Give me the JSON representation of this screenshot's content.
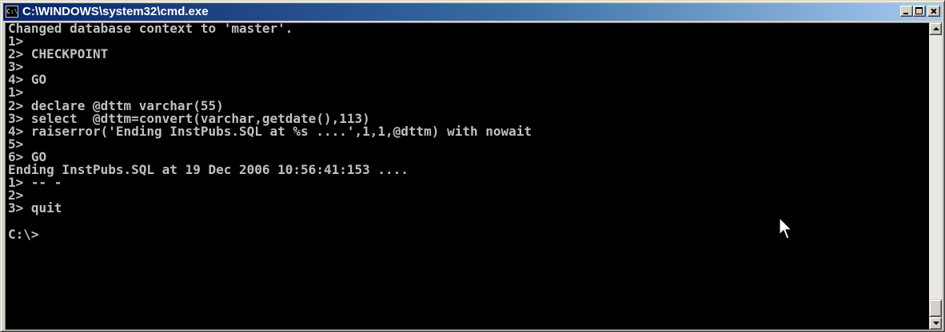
{
  "window": {
    "title": "C:\\WINDOWS\\system32\\cmd.exe",
    "icon_label": "C:\\"
  },
  "console": {
    "lines": [
      "Changed database context to 'master'.",
      "1>",
      "2> CHECKPOINT",
      "3>",
      "4> GO",
      "1>",
      "2> declare @dttm varchar(55)",
      "3> select  @dttm=convert(varchar,getdate(),113)",
      "4> raiserror('Ending InstPubs.SQL at %s ....',1,1,@dttm) with nowait",
      "5>",
      "6> GO",
      "Ending InstPubs.SQL at 19 Dec 2006 10:56:41:153 ....",
      "1> -- -",
      "2>",
      "3> quit",
      "",
      "C:\\>"
    ],
    "text_color": "#c0c0c0",
    "background": "#000000"
  },
  "scrollbar": {
    "position": "bottom"
  },
  "colors": {
    "titlebar_start": "#0a246a",
    "titlebar_end": "#a6caf0",
    "chrome": "#d4d0c8"
  }
}
